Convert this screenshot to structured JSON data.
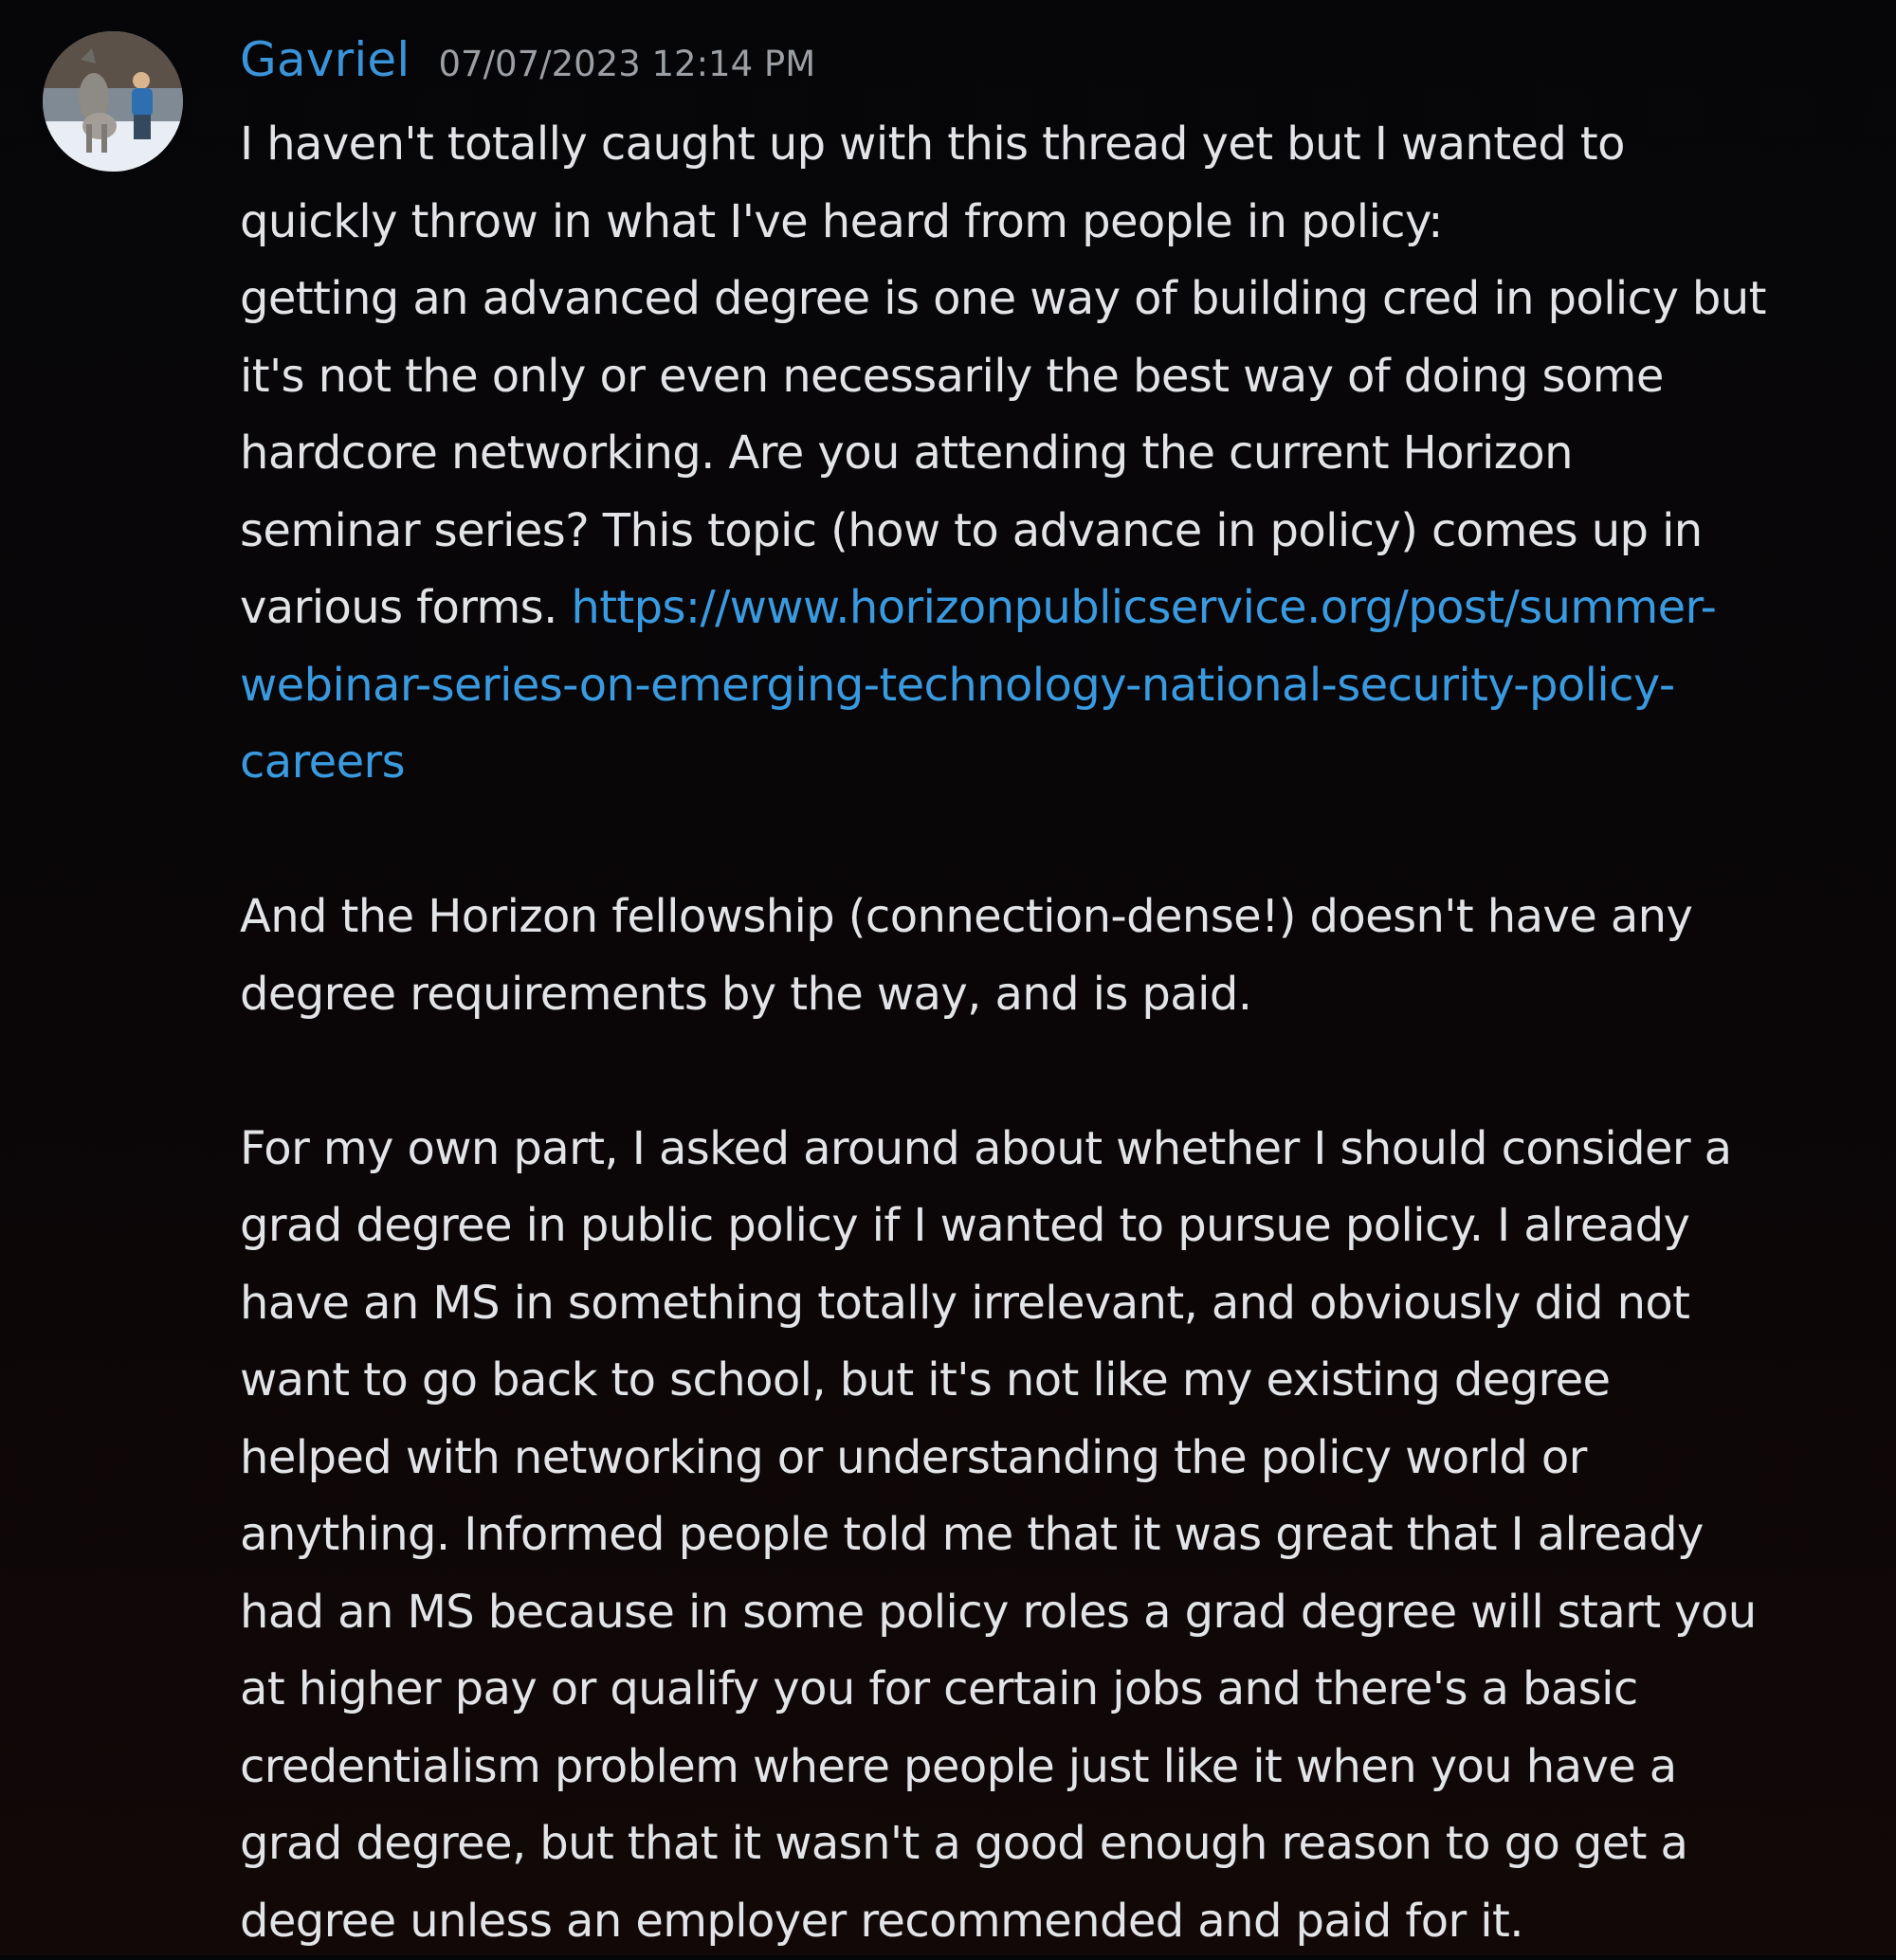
{
  "message": {
    "author": {
      "username": "Gavriel",
      "avatar_icon": "wolf-photo-avatar",
      "name_color": "#3b94d9"
    },
    "timestamp": "07/07/2023 12:14 PM",
    "paragraph1": {
      "line1": "I haven't totally caught up with this thread yet but I wanted to",
      "line2": "quickly throw in what I've heard from people in policy:",
      "line3": "getting an advanced degree is one way of building cred in policy but",
      "line4": "it's not the only or even necessarily the best way of doing some",
      "line5": "hardcore networking. Are you attending the current Horizon",
      "line6": "seminar series? This topic (how to advance in policy) comes up in",
      "line7_prefix": "various forms. ",
      "link": {
        "line1": "https://www.horizonpublicservice.org/post/summer-",
        "line2": "webinar-series-on-emerging-technology-national-security-policy-",
        "line3": "careers",
        "color": "#3a9ae0"
      }
    },
    "paragraph2": {
      "line1": "And the Horizon fellowship (connection-dense!) doesn't have any",
      "line2": "degree requirements by the way, and is paid."
    },
    "paragraph3": {
      "line1": "For my own part, I asked around about whether I should consider a",
      "line2": "grad degree in public policy if I wanted to pursue policy. I already",
      "line3": "have an MS in something totally irrelevant, and obviously did not",
      "line4": "want to go back to school, but it's not like my existing degree",
      "line5": "helped with networking or understanding the policy world or",
      "line6": "anything. Informed people told me that it was great that I already",
      "line7": "had an MS because in some policy roles a grad degree will start you",
      "line8": "at higher pay or qualify you for certain jobs and there's a basic",
      "line9": "credentialism problem where people just like it when you have a",
      "line10": "grad degree, but that it wasn't a good enough reason to go get a",
      "line11": "degree unless an employer recommended and paid for it."
    }
  }
}
